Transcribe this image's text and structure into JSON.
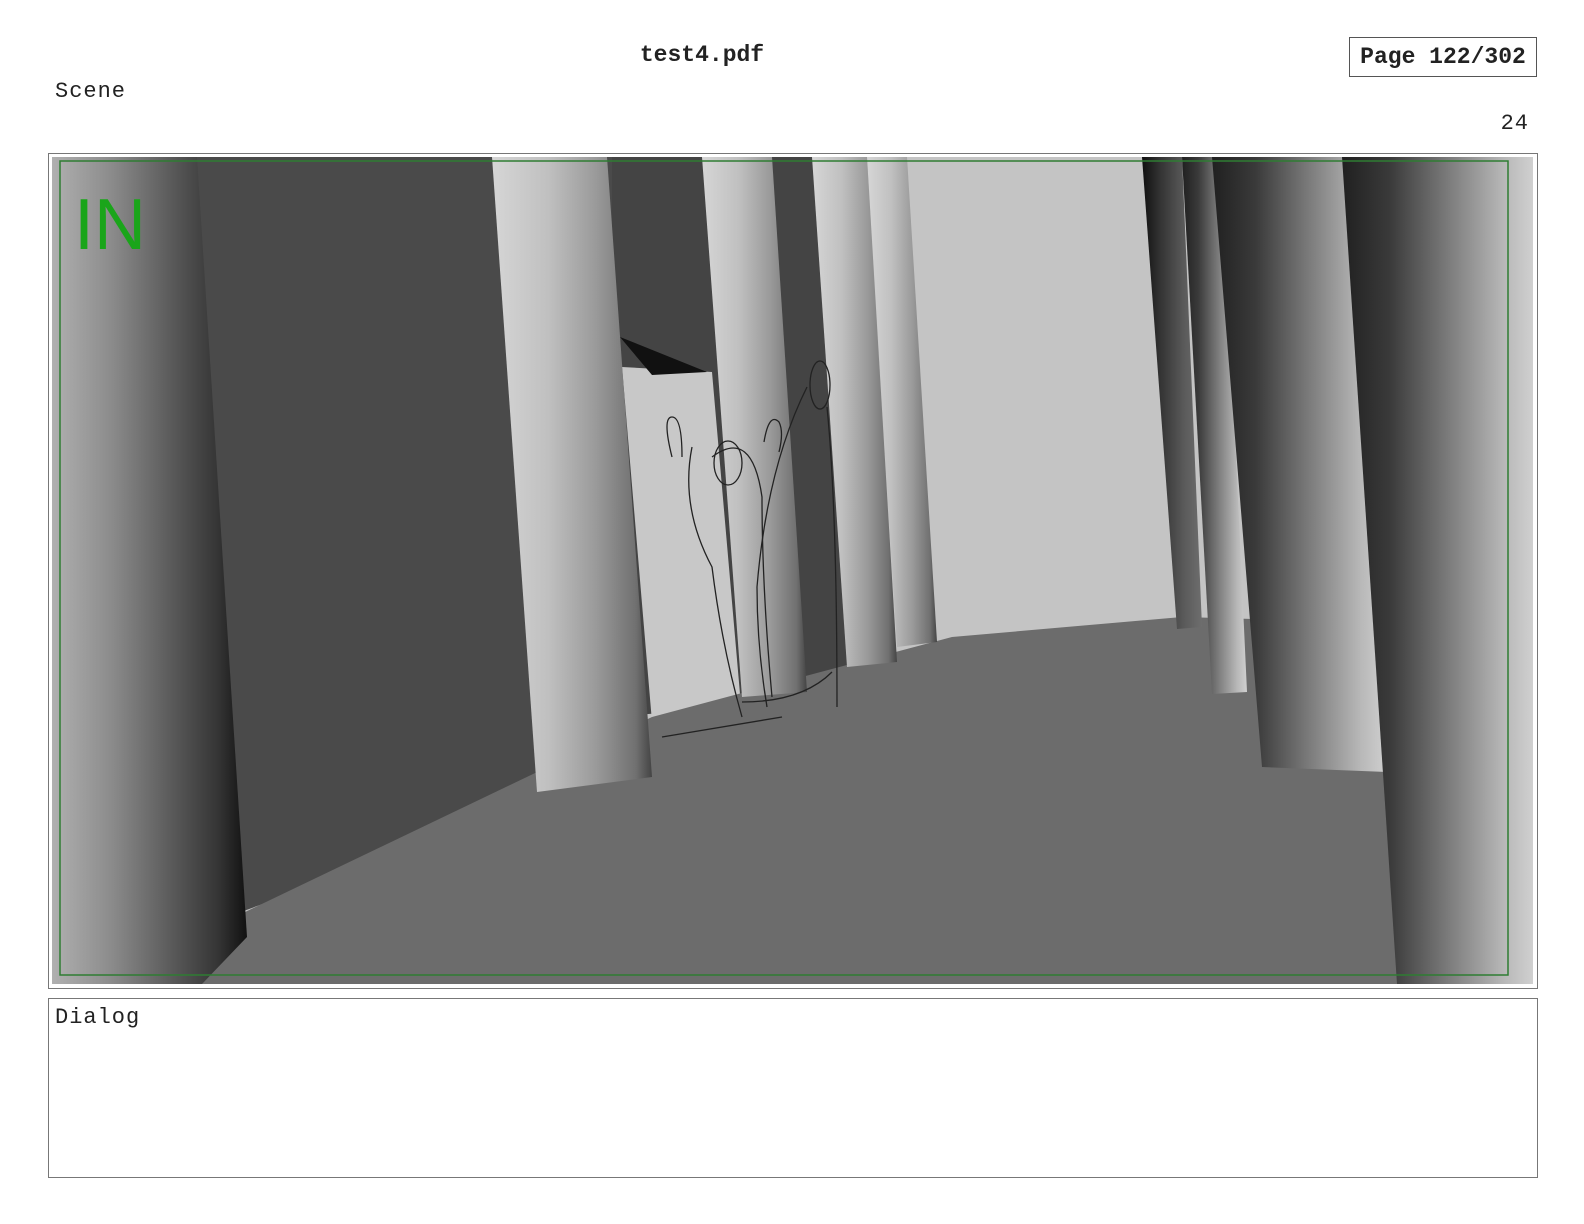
{
  "header": {
    "document_title": "test4.pdf",
    "page_indicator": "Page 122/302"
  },
  "scene": {
    "label": "Scene",
    "panel_number": "24"
  },
  "frame": {
    "badge": "IN",
    "badge_color": "#1aa51a",
    "safe_area_color": "#2e7d32"
  },
  "dialog": {
    "label": "Dialog"
  }
}
